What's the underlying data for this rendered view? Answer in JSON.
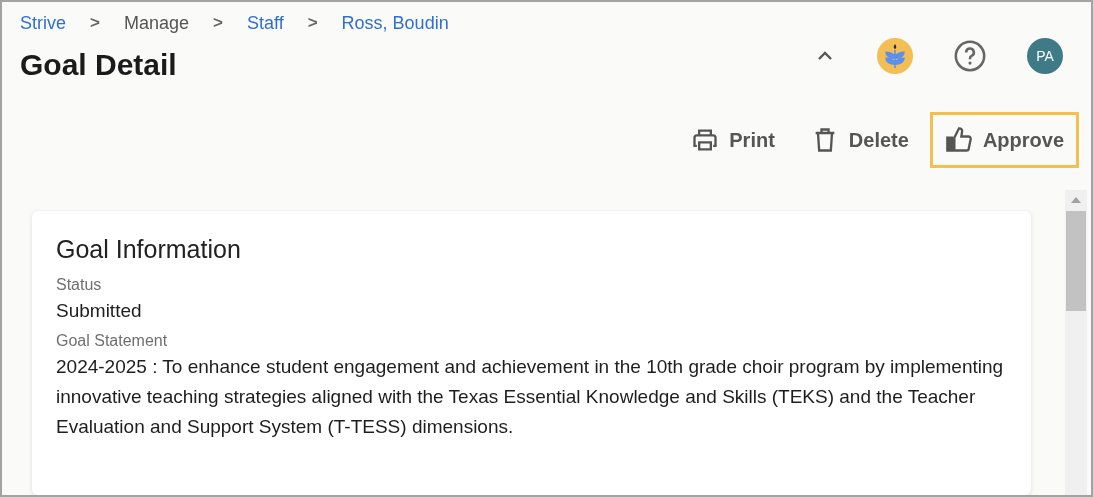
{
  "breadcrumb": [
    {
      "label": "Strive",
      "link": true
    },
    {
      "label": "Manage",
      "link": false
    },
    {
      "label": "Staff",
      "link": true
    },
    {
      "label": "Ross, Boudin",
      "link": true
    }
  ],
  "breadcrumb_separator": ">",
  "title": "Goal Detail",
  "header_icons": [
    {
      "kind": "collapse"
    },
    {
      "kind": "logo"
    },
    {
      "kind": "help"
    },
    {
      "kind": "avatar",
      "initials": "PA"
    }
  ],
  "actions": [
    {
      "kind": "print",
      "label": "Print",
      "highlighted": false
    },
    {
      "kind": "delete",
      "label": "Delete",
      "highlighted": false
    },
    {
      "kind": "approve",
      "label": "Approve",
      "highlighted": true
    }
  ],
  "card": {
    "title": "Goal Information",
    "fields": [
      {
        "label": "Status",
        "value": "Submitted"
      },
      {
        "label": "Goal Statement",
        "value": "2024-2025 : To enhance student engagement and achievement in the 10th grade choir program by implementing innovative teaching strategies aligned with the Texas Essential Knowledge and Skills (TEKS) and the Teacher Evaluation and Support System (T-TESS) dimensions."
      }
    ]
  }
}
